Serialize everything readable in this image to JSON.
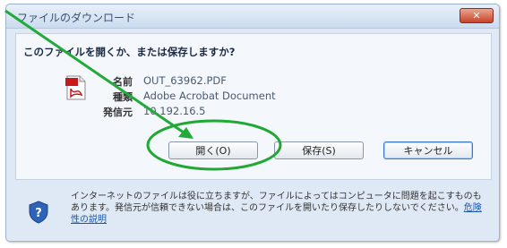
{
  "dialog": {
    "title": "ファイルのダウンロード",
    "close_label": "✕",
    "question": "このファイルを開くか、または保存しますか?",
    "file": {
      "name_label": "名前",
      "name_value": "OUT_63962.PDF",
      "type_label": "種類",
      "type_value": "Adobe Acrobat Document",
      "from_label": "発信元",
      "from_value": "10.192.16.5"
    },
    "buttons": {
      "open": "開く(O)",
      "save": "保存(S)",
      "cancel": "キャンセル"
    },
    "footer": {
      "warning": "インターネットのファイルは役に立ちますが、ファイルによってはコンピュータに問題を起こすものもあります。発信元が信頼できない場合は、このファイルを開いたり保存したりしないでください。",
      "link": "危険性の説明"
    }
  },
  "annotation": {
    "arrow_color": "#22aa3a",
    "ellipse_color": "#1fa833"
  }
}
